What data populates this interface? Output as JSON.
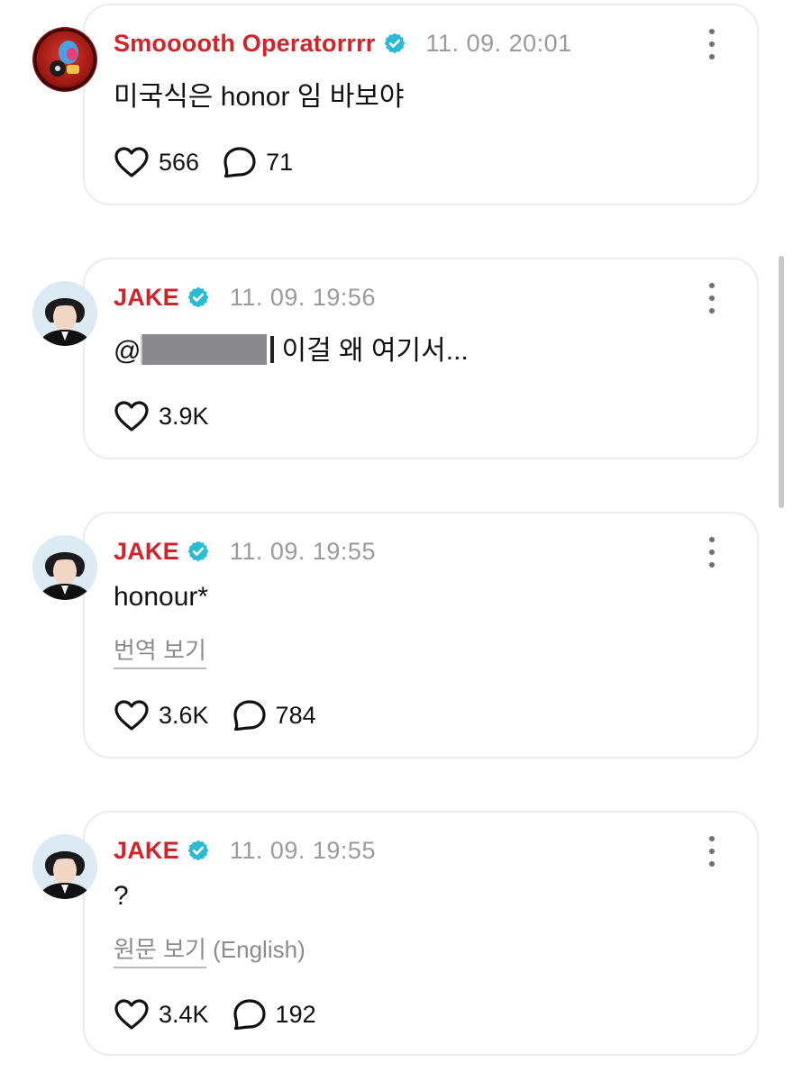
{
  "comments": [
    {
      "author": "Smooooth Operatorrrr",
      "timestamp": "11. 09. 20:01",
      "text": "미국식은 honor 임 바보야",
      "likes": "566",
      "replies": "71"
    },
    {
      "author": "JAKE",
      "timestamp": "11. 09. 19:56",
      "mention_prefix": "@",
      "text_after_mention": "이걸 왜 여기서...",
      "likes": "3.9K"
    },
    {
      "author": "JAKE",
      "timestamp": "11. 09. 19:55",
      "text": "honour*",
      "translate_link": "번역 보기",
      "likes": "3.6K",
      "replies": "784"
    },
    {
      "author": "JAKE",
      "timestamp": "11. 09. 19:55",
      "text": "?",
      "translate_link": "원문 보기",
      "translate_suffix": "(English)",
      "likes": "3.4K",
      "replies": "192"
    }
  ],
  "colors": {
    "author": "#d0242b",
    "verified_badge": "#2bbad3",
    "timestamp": "#9a9aa0"
  },
  "icons": {
    "verified": "verified-badge-icon",
    "like": "heart-icon",
    "reply": "speech-bubble-icon",
    "more": "more-vertical-icon"
  }
}
